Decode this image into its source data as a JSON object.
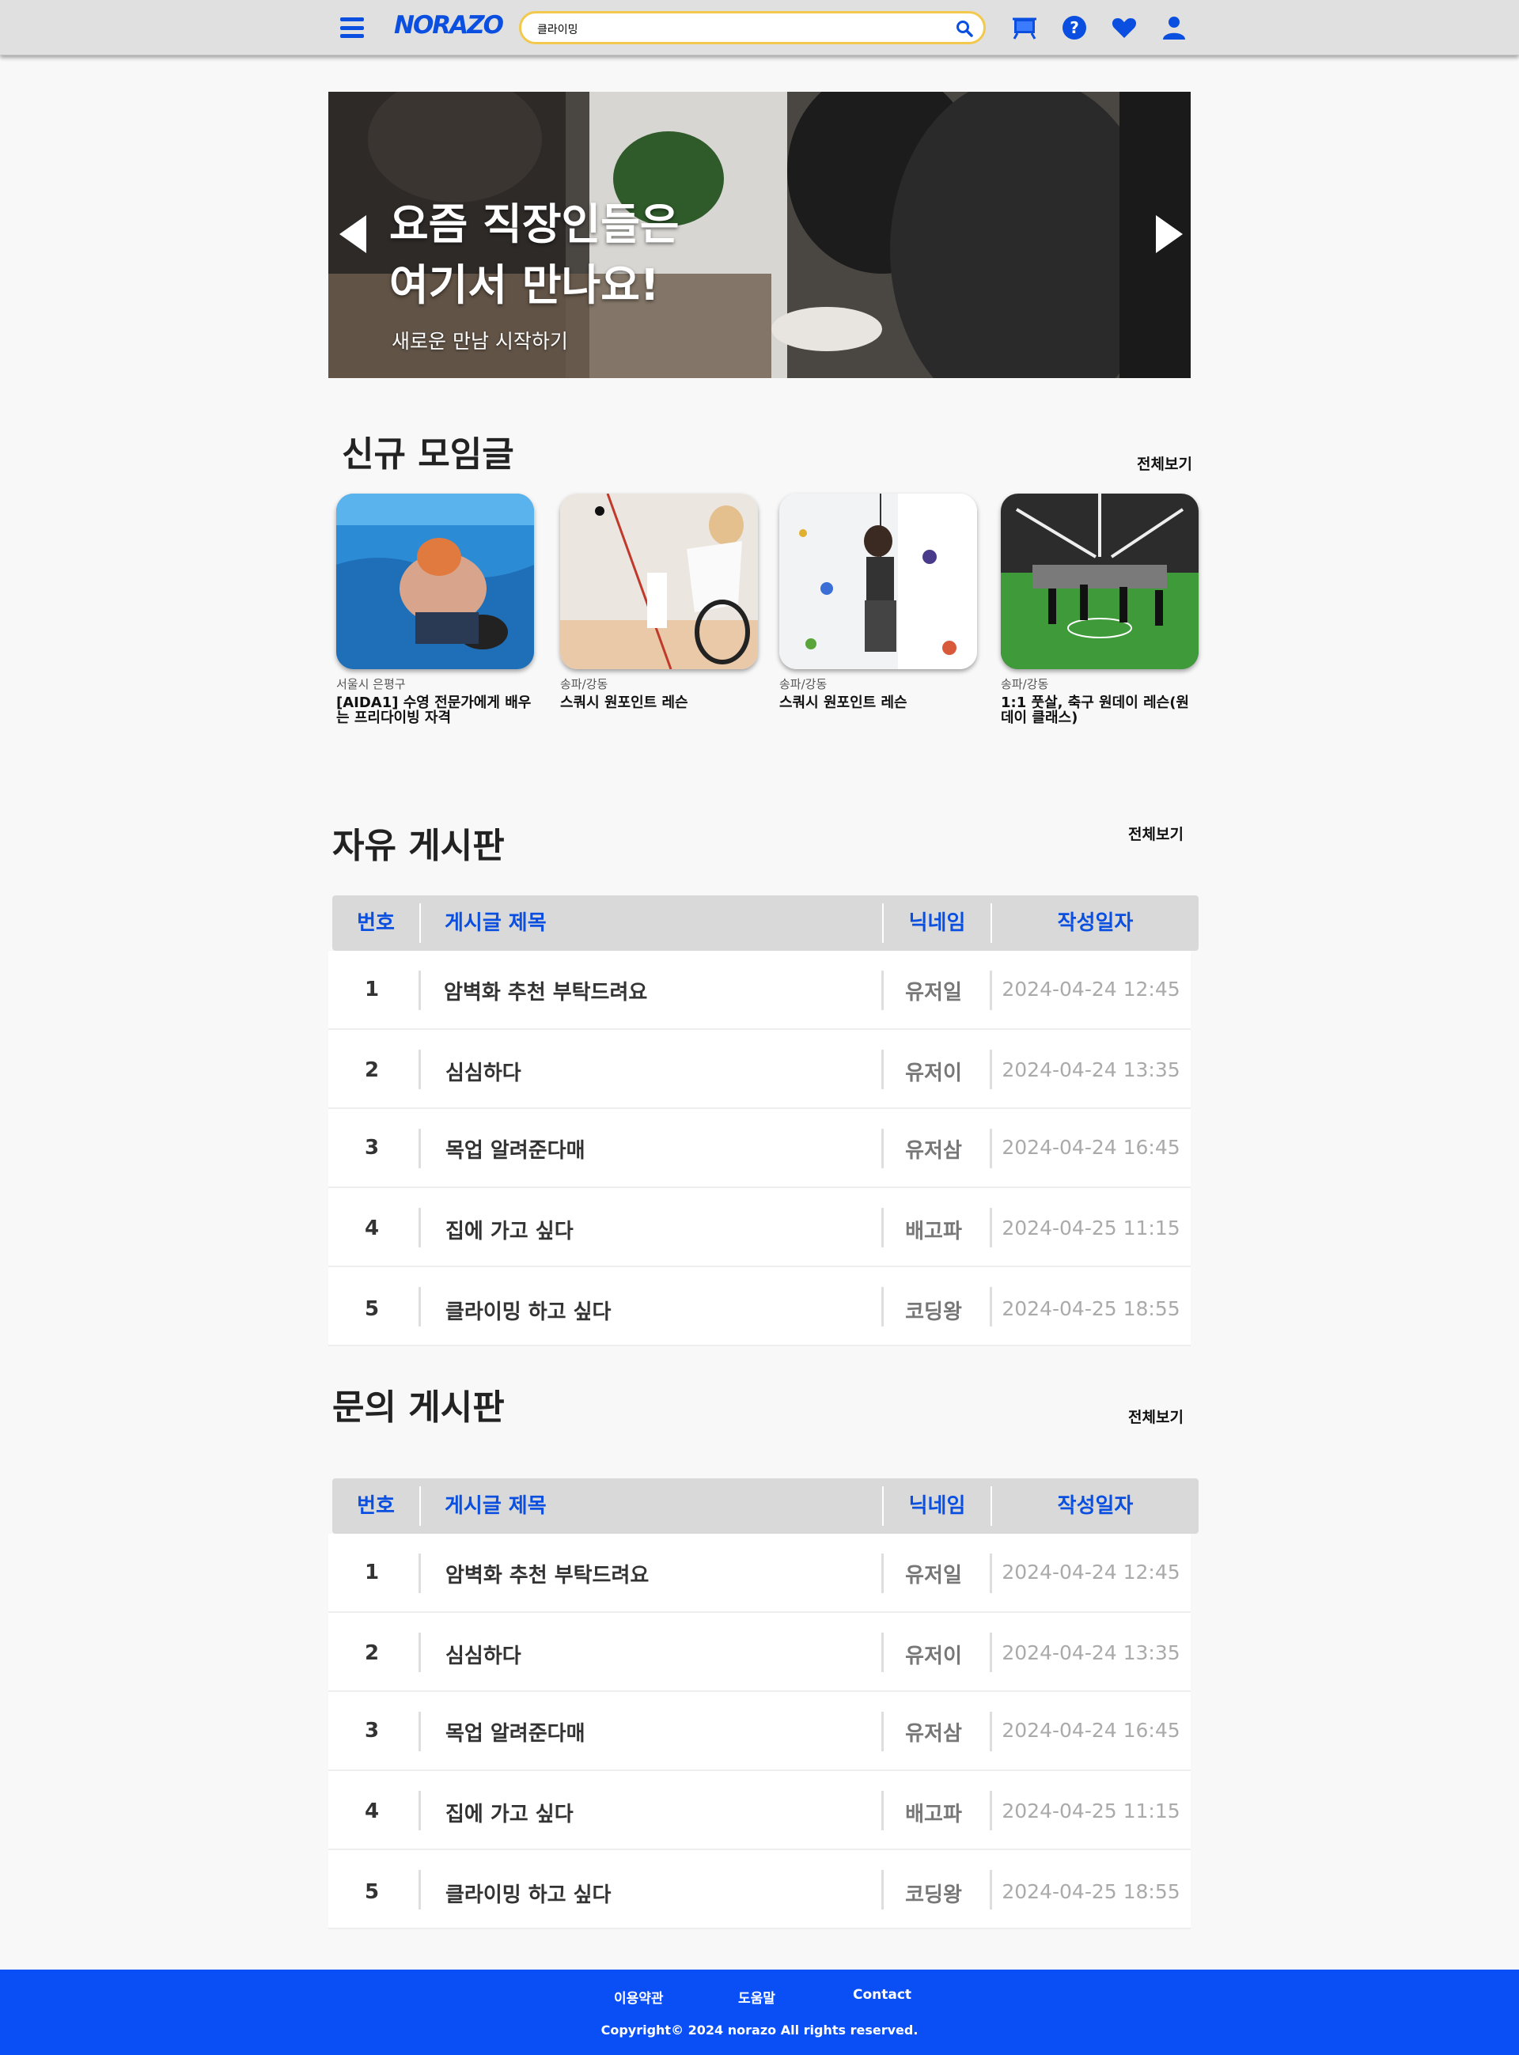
{
  "header": {
    "logo": "NORAZO",
    "search_value": "클라이밍",
    "icons": [
      "menu-icon",
      "search-icon",
      "board-icon",
      "help-icon",
      "heart-icon",
      "user-icon"
    ],
    "colors": {
      "brand": "#0a4fe0",
      "search_border": "#f2c94c",
      "header_bg": "#e0e0e0"
    }
  },
  "banner": {
    "title_line1": "요즘 직장인들은",
    "title_line2": "여기서 만나요!",
    "subtitle": "새로운 만남 시작하기"
  },
  "new_meetings": {
    "title": "신규 모임글",
    "see_all": "전체보기",
    "cards": [
      {
        "region": "서울시 은평구",
        "title": "[AIDA1] 수영 전문가에게 배우는 프리다이빙 자격"
      },
      {
        "region": "송파/강동",
        "title": "스쿼시 원포인트 레슨"
      },
      {
        "region": "송파/강동",
        "title": "스쿼시 원포인트 레슨"
      },
      {
        "region": "송파/강동",
        "title": "1:1 풋살, 축구 원데이 레슨(원데이 클래스)"
      }
    ]
  },
  "free_board": {
    "title": "자유 게시판",
    "see_all": "전체보기",
    "columns": [
      "번호",
      "게시글 제목",
      "닉네임",
      "작성일자"
    ],
    "rows": [
      {
        "no": "1",
        "title": "암벽화 추천 부탁드려요",
        "nick": "유저일",
        "date": "2024-04-24 12:45"
      },
      {
        "no": "2",
        "title": "심심하다",
        "nick": "유저이",
        "date": "2024-04-24 13:35"
      },
      {
        "no": "3",
        "title": "목업 알려준다매",
        "nick": "유저삼",
        "date": "2024-04-24 16:45"
      },
      {
        "no": "4",
        "title": "집에 가고 싶다",
        "nick": "배고파",
        "date": "2024-04-25 11:15"
      },
      {
        "no": "5",
        "title": "클라이밍 하고 싶다",
        "nick": "코딩왕",
        "date": "2024-04-25 18:55"
      }
    ]
  },
  "qna_board": {
    "title": "문의 게시판",
    "see_all": "전체보기",
    "columns": [
      "번호",
      "게시글 제목",
      "닉네임",
      "작성일자"
    ],
    "rows": [
      {
        "no": "1",
        "title": "암벽화 추천 부탁드려요",
        "nick": "유저일",
        "date": "2024-04-24 12:45"
      },
      {
        "no": "2",
        "title": "심심하다",
        "nick": "유저이",
        "date": "2024-04-24 13:35"
      },
      {
        "no": "3",
        "title": "목업 알려준다매",
        "nick": "유저삼",
        "date": "2024-04-24 16:45"
      },
      {
        "no": "4",
        "title": "집에 가고 싶다",
        "nick": "배고파",
        "date": "2024-04-25 11:15"
      },
      {
        "no": "5",
        "title": "클라이밍 하고 싶다",
        "nick": "코딩왕",
        "date": "2024-04-25 18:55"
      }
    ]
  },
  "footer": {
    "links": [
      "이용약관",
      "도움말",
      "Contact"
    ],
    "copyright": "Copyright© 2024 norazo All rights reserved.",
    "bg_color": "#0a4ff5"
  }
}
